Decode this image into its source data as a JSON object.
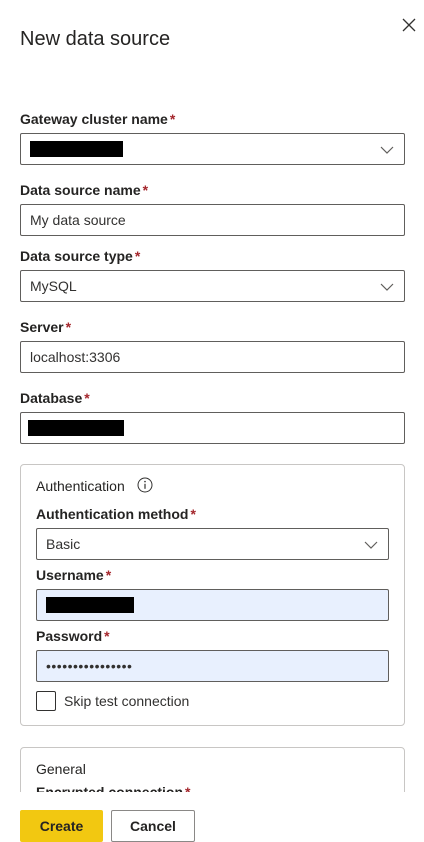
{
  "dialog": {
    "title": "New data source",
    "close_icon": "close-icon"
  },
  "form": {
    "required_marker": "*",
    "gateway": {
      "label": "Gateway cluster name",
      "value_redacted": true
    },
    "ds_name": {
      "label": "Data source name",
      "value": "My data source"
    },
    "ds_type": {
      "label": "Data source type",
      "value": "MySQL"
    },
    "server": {
      "label": "Server",
      "value": "localhost:3306"
    },
    "database": {
      "label": "Database",
      "value_redacted": true
    },
    "auth": {
      "section_title": "Authentication",
      "info_icon": "info-icon",
      "method": {
        "label": "Authentication method",
        "value": "Basic"
      },
      "username": {
        "label": "Username",
        "value_redacted": true
      },
      "password": {
        "label": "Password",
        "value": "••••••••••••••••"
      },
      "skip_test": {
        "label": "Skip test connection",
        "checked": false
      }
    },
    "general": {
      "section_title": "General",
      "encrypted_label": "Encrypted connection"
    }
  },
  "footer": {
    "create_label": "Create",
    "cancel_label": "Cancel"
  },
  "colors": {
    "primary": "#f2c811",
    "required": "#a4262c",
    "autofill": "#e8f0fe"
  }
}
